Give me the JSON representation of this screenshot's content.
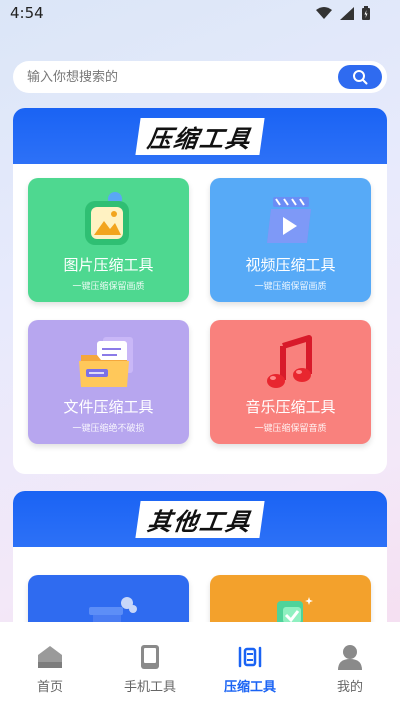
{
  "status": {
    "time": "4:54"
  },
  "search": {
    "placeholder": "输入你想搜索的"
  },
  "compress_section": {
    "title": "压缩工具",
    "cards": [
      {
        "title": "图片压缩工具",
        "subtitle": "一键压缩保留画质",
        "color": "#4ed890"
      },
      {
        "title": "视频压缩工具",
        "subtitle": "一键压缩保留画质",
        "color": "#57aaf7"
      },
      {
        "title": "文件压缩工具",
        "subtitle": "一键压缩绝不破损",
        "color": "#b7a6ef"
      },
      {
        "title": "音乐压缩工具",
        "subtitle": "一键压缩保留音质",
        "color": "#f9817d"
      }
    ]
  },
  "other_section": {
    "title": "其他工具",
    "cards": [
      {
        "color": "#2f6bf0"
      },
      {
        "color": "#f3a12c"
      }
    ]
  },
  "bottom_nav": [
    {
      "label": "首页",
      "icon": "home-icon"
    },
    {
      "label": "手机工具",
      "icon": "phone-icon"
    },
    {
      "label": "压缩工具",
      "icon": "compress-icon",
      "active": true
    },
    {
      "label": "我的",
      "icon": "user-icon"
    }
  ]
}
